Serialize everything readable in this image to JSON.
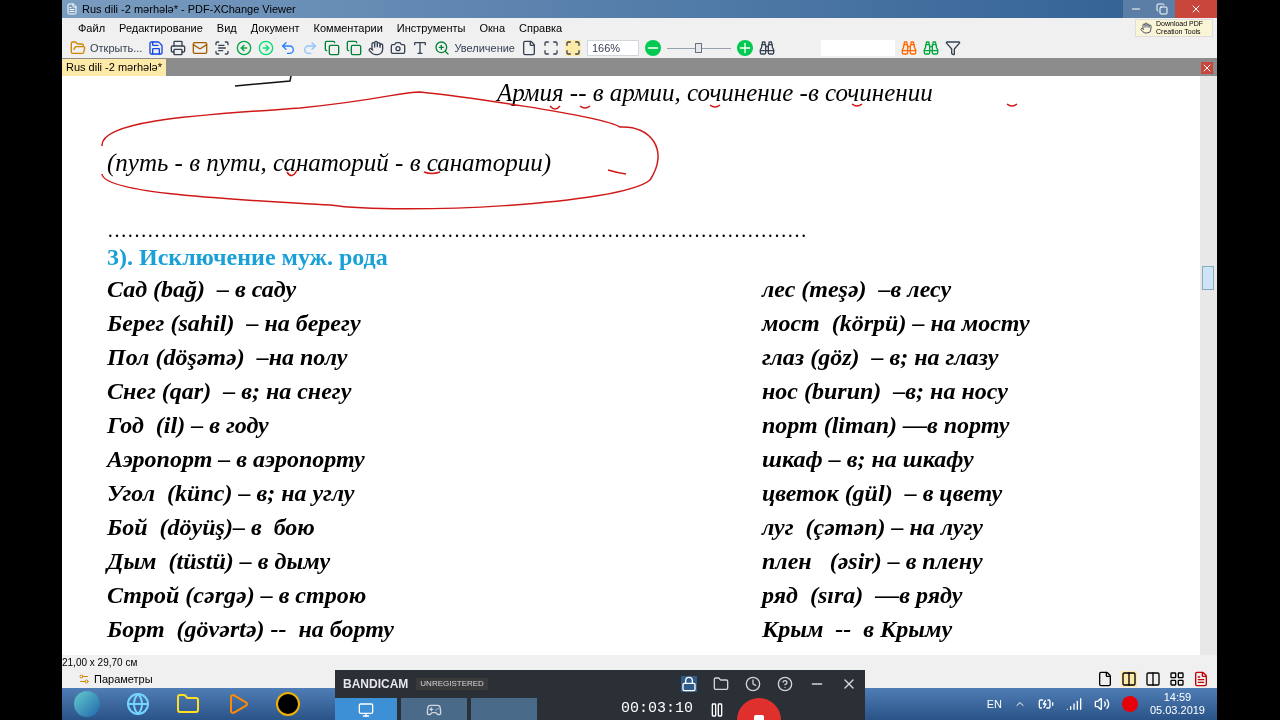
{
  "window": {
    "title": "Rus dili -2 mərhələ* - PDF-XChange Viewer"
  },
  "menu": [
    "Файл",
    "Редактирование",
    "Вид",
    "Документ",
    "Комментарии",
    "Инструменты",
    "Окна",
    "Справка"
  ],
  "toolbar": {
    "open_label": "Открыть...",
    "zoom_label": "Увеличение",
    "zoom_value": "166%",
    "zoom_slider": {
      "level": 0.5
    },
    "promo": "Download PDF Creation Tools"
  },
  "tabs": [
    {
      "label": "Rus dili -2 mərhələ*",
      "selected": true
    }
  ],
  "document": {
    "line_1": "Армия -- в армии, сочинение -в сочинении",
    "line_2": "(путь - в пути, санаторий - в санатории)",
    "separator": "……………………………………………………………………………………………",
    "heading": "3). Исключение  муж. рода",
    "rows": [
      {
        "left": "Сад (bağ)  – в саду",
        "right": "лес (meşə)  –в лесу"
      },
      {
        "left": "Берег (sahil)  – на берегу",
        "right": "мост  (körpü) – на мосту"
      },
      {
        "left": "Пол (döşəmə)  –на полу",
        "right": "глаз (göz)  – в; на глазу"
      },
      {
        "left": "Снег (qar)  – в; на снегу",
        "right": "нос (burun)  –в; на носу"
      },
      {
        "left": "Год  (il) – в году",
        "right": "порт (liman) —в порту"
      },
      {
        "left": "Аэропорт – в аэропорту",
        "right": "шкаф – в; на шкафу"
      },
      {
        "left": "Угол  (künc) – в; на углу",
        "right": "цветок (gül)  – в цвету"
      },
      {
        "left": "Бой  (döyüş)– в  бою",
        "right": "луг  (çəmən) – на лугу"
      },
      {
        "left": "Дым  (tüstü) – в дыму",
        "right": "плен   (əsir) – в плену"
      },
      {
        "left": "Строй (cərgə) – в строю",
        "right": "ряд  (sıra)  —в ряду"
      },
      {
        "left": "Борт  (gövərtə) --  на борту",
        "right": "Крым  --  в Крыму"
      }
    ]
  },
  "status_bar": {
    "page_size": "21,00 x 29,70 см",
    "options_label": "Параметры"
  },
  "recorder": {
    "brand": "BANDICAM",
    "badge": "UNREGISTERED",
    "timer": "00:03:10"
  },
  "taskbar": {
    "language": "EN",
    "time": "14:59",
    "date": "05.03.2019"
  }
}
